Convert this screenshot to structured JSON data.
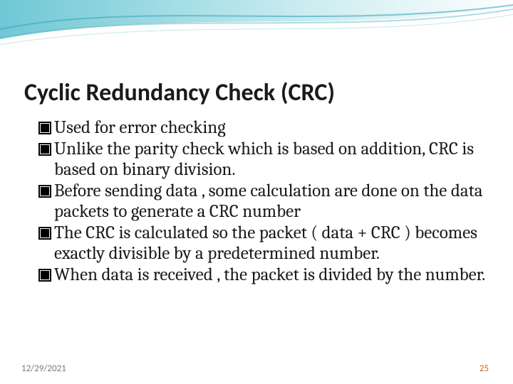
{
  "slide": {
    "title": "Cyclic Redundancy Check (CRC)",
    "bullets": [
      "Used for error checking",
      "Unlike the parity check which is based on addition, CRC is based on binary division.",
      "Before sending data , some calculation are done on the data packets to generate a  CRC number",
      "The CRC is calculated so the packet ( data + CRC ) becomes exactly divisible by a predetermined number.",
      "When data is received , the packet is divided by the number."
    ],
    "footer": {
      "date": "12/29/2021",
      "page": "25"
    }
  }
}
